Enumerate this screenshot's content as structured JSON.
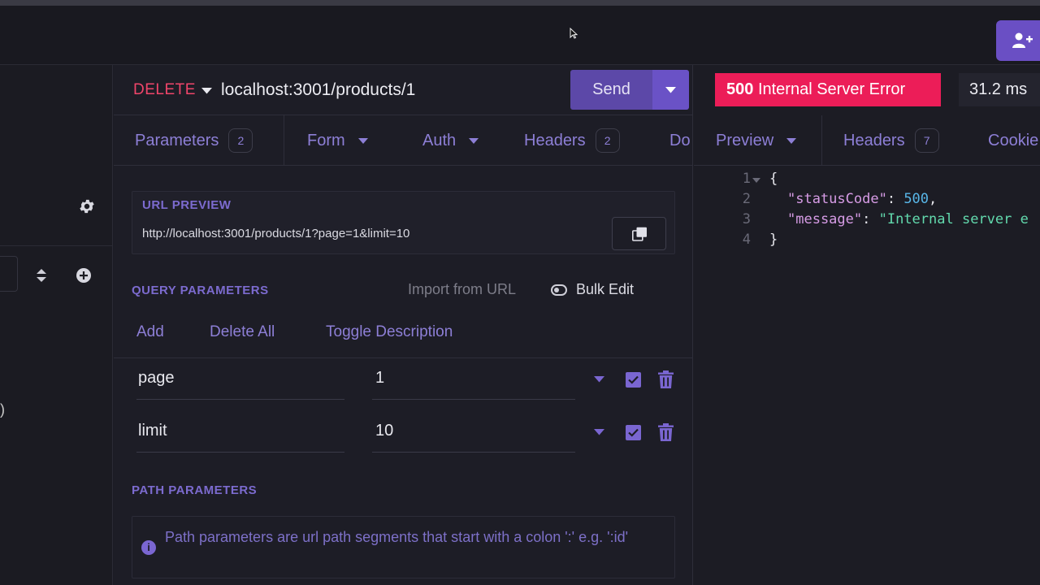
{
  "request": {
    "method": "DELETE",
    "url": "localhost:3001/products/1",
    "send_label": "Send",
    "tabs": [
      {
        "label": "Parameters",
        "count": "2"
      },
      {
        "label": "Form"
      },
      {
        "label": "Auth"
      },
      {
        "label": "Headers",
        "count": "2"
      },
      {
        "label": "Do"
      }
    ],
    "url_preview": {
      "label": "URL PREVIEW",
      "value": "http://localhost:3001/products/1?page=1&limit=10"
    },
    "query": {
      "label": "QUERY PARAMETERS",
      "import_label": "Import from URL",
      "bulk_edit_label": "Bulk Edit",
      "actions": {
        "add": "Add",
        "delete_all": "Delete All",
        "toggle_description": "Toggle Description"
      },
      "params": [
        {
          "name": "page",
          "value": "1",
          "enabled": true
        },
        {
          "name": "limit",
          "value": "10",
          "enabled": true
        }
      ]
    },
    "path": {
      "label": "PATH PARAMETERS",
      "info": "Path parameters are url path segments that start with a colon ':' e.g. ':id'"
    }
  },
  "response": {
    "status_code": "500",
    "status_text": "Internal Server Error",
    "time": "31.2 ms",
    "tabs": [
      {
        "label": "Preview"
      },
      {
        "label": "Headers",
        "count": "7"
      },
      {
        "label": "Cookie"
      }
    ],
    "body": {
      "line_numbers": [
        "1",
        "2",
        "3",
        "4"
      ],
      "open_brace": "{",
      "close_brace": "}",
      "status_key": "\"statusCode\"",
      "status_value": "500",
      "message_key": "\"message\"",
      "message_value": "\"Internal server e"
    }
  },
  "colors": {
    "accent": "#7a66d1",
    "method_delete": "#f0456a",
    "status_error": "#ec1d58"
  }
}
